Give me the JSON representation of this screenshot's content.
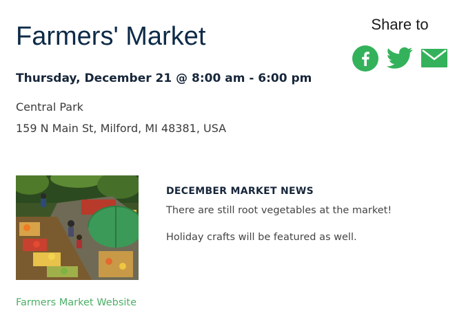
{
  "event": {
    "title": "Farmers' Market",
    "date": "Thursday, December 21 @ 8:00 am - 6:00 pm",
    "venue": "Central Park",
    "address": "159 N Main St, Milford, MI 48381, USA"
  },
  "share": {
    "label": "Share to",
    "icons": [
      "facebook-icon",
      "twitter-icon",
      "email-icon"
    ],
    "accent": "#34b25b"
  },
  "news": {
    "title": "DECEMBER MARKET NEWS",
    "lines": [
      "There are still root vegetables at the market!",
      "Holiday crafts will be featured as well."
    ]
  },
  "link": {
    "label": "Farmers Market Website",
    "color": "#4caf66"
  }
}
